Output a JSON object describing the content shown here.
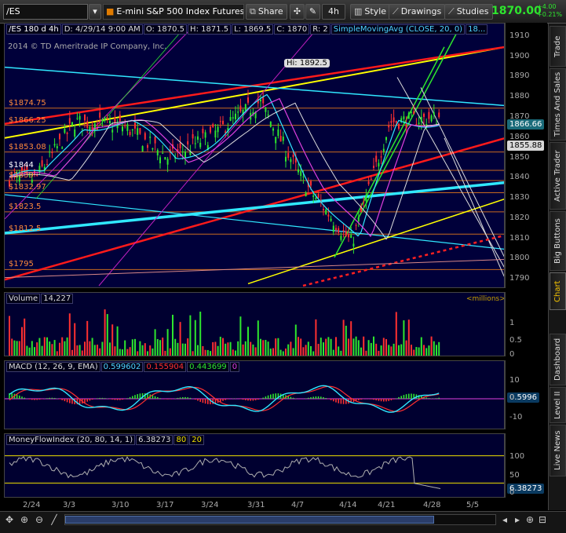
{
  "toolbar": {
    "symbol": "/ES",
    "description": "E-mini S&P 500 Index Futures,ET...",
    "share_label": "Share",
    "timeframe": "4h",
    "style_label": "Style",
    "drawings_label": "Drawings",
    "studies_label": "Studies",
    "last_price": "1870.00",
    "change": "+4.00",
    "change_pct": "+0.21%"
  },
  "sidebar": {
    "tabs": [
      "Trade",
      "Times And Sales",
      "Active Trader",
      "Big Buttons",
      "Chart",
      "Dashboard",
      "Level II",
      "Live News"
    ],
    "active": "Chart"
  },
  "price_pane": {
    "header": {
      "symbol_tf": "/ES 180 d 4h",
      "date": "D: 4/29/14 9:00 AM",
      "open": "O: 1870.5",
      "high": "H: 1871.5",
      "low": "L: 1869.5",
      "close": "C: 1870",
      "range": "R: 2",
      "study": "SimpleMovingAvg (CLOSE, 20, 0)",
      "study_value": "18..."
    },
    "copyright": "2014 © TD Ameritrade IP Company, Inc.",
    "hi_label": "Hi: 1892.5",
    "levels": [
      "$1874.75",
      "$1866.25",
      "$1853.08",
      "$1844",
      "$1839",
      "$1832.97",
      "$1823.5",
      "$1812.5",
      "$1795"
    ],
    "axis_ticks": [
      "1910",
      "1900",
      "1890",
      "1880",
      "1870",
      "1860",
      "1850",
      "1840",
      "1830",
      "1820",
      "1810",
      "1800",
      "1790"
    ],
    "price_tags": [
      "1866.66",
      "1855.88"
    ],
    "tag_colors": [
      "#1a6b7a",
      "#d8d8d8"
    ]
  },
  "volume_pane": {
    "header": {
      "title": "Volume",
      "value": "14,227"
    },
    "unit": "<millions>",
    "axis_ticks": [
      "1",
      "0.5",
      "0"
    ]
  },
  "macd_pane": {
    "header": {
      "title": "MACD (12, 26, 9, EMA)",
      "v1": "0.599602",
      "v2": "0.155904",
      "v3": "0.443699",
      "v4": "0"
    },
    "axis_ticks": [
      "10",
      "0",
      "-10"
    ],
    "value_tag": "0.5996"
  },
  "mfi_pane": {
    "header": {
      "title": "MoneyFlowIndex (20, 80, 14, 1)",
      "v1": "6.38273",
      "v2": "80",
      "v3": "20"
    },
    "axis_ticks": [
      "100",
      "50",
      "0"
    ],
    "value_tag": "6.38273"
  },
  "x_axis": {
    "dates": [
      "2/24",
      "3/3",
      "3/10",
      "3/17",
      "3/24",
      "3/31",
      "4/7",
      "4/14",
      "4/21",
      "4/28",
      "5/5"
    ]
  },
  "chart_data": {
    "type": "candlestick",
    "symbol": "/ES",
    "timeframe": "4h",
    "ylim": [
      1787,
      1915
    ],
    "dates": [
      "2/24",
      "3/3",
      "3/10",
      "3/17",
      "3/24",
      "3/31",
      "4/7",
      "4/14",
      "4/21",
      "4/28",
      "5/5"
    ],
    "approx_close_path": [
      {
        "x": "2/24",
        "y": 1840
      },
      {
        "x": "3/3",
        "y": 1868
      },
      {
        "x": "3/10",
        "y": 1866
      },
      {
        "x": "3/17",
        "y": 1850
      },
      {
        "x": "3/24",
        "y": 1862
      },
      {
        "x": "3/31",
        "y": 1878
      },
      {
        "x": "4/7",
        "y": 1838
      },
      {
        "x": "4/14",
        "y": 1808
      },
      {
        "x": "4/21",
        "y": 1868
      },
      {
        "x": "4/28",
        "y": 1870
      }
    ],
    "last": {
      "open": 1870.5,
      "high": 1871.5,
      "low": 1869.5,
      "close": 1870
    },
    "hi": 1892.5,
    "horizontal_levels": [
      1874.75,
      1866.25,
      1853.08,
      1844,
      1839,
      1832.97,
      1823.5,
      1812.5,
      1795
    ],
    "sma20_last": 1855.88,
    "volume_last": 14227,
    "macd": {
      "value": 0.599602,
      "avg": 0.155904,
      "diff": 0.443699
    },
    "mfi": {
      "value": 6.38273,
      "overbought": 80,
      "oversold": 20
    }
  }
}
